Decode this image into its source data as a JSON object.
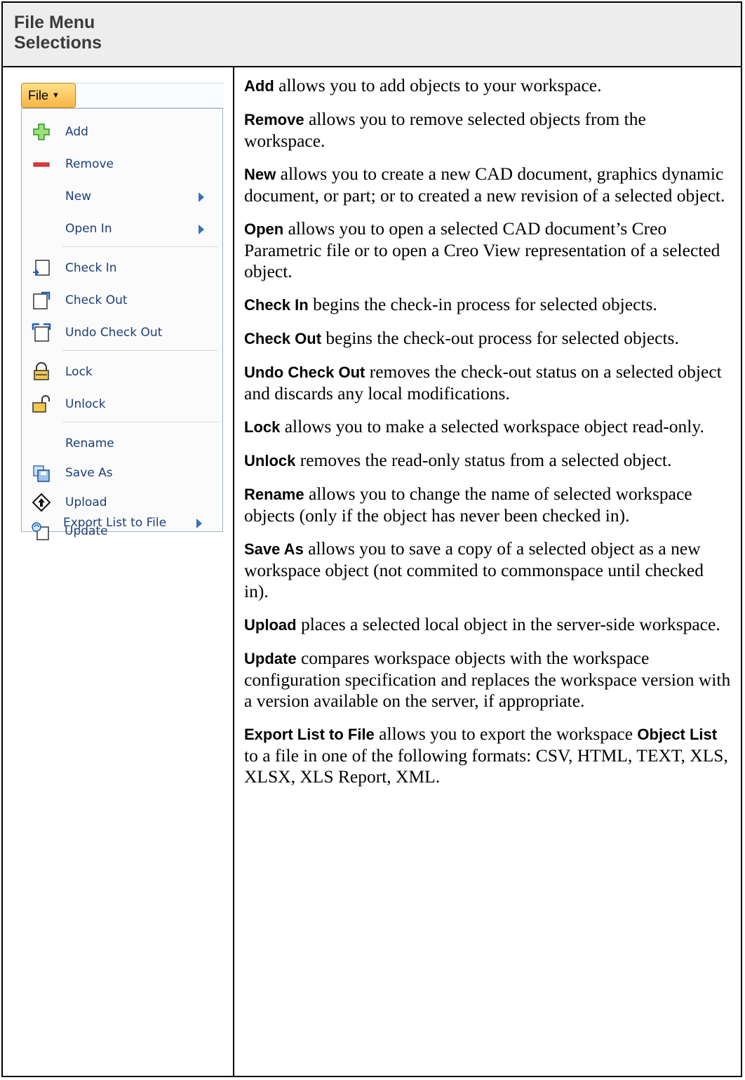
{
  "header": {
    "title_line1": "File Menu",
    "title_line2": "Selections"
  },
  "menu": {
    "file_button": "File",
    "items": [
      {
        "label": "Add",
        "icon": "add-icon",
        "submenu": false
      },
      {
        "label": "Remove",
        "icon": "remove-icon",
        "submenu": false
      },
      {
        "label": "New",
        "icon": "",
        "submenu": true
      },
      {
        "label": "Open In",
        "icon": "",
        "submenu": true
      },
      {
        "label": "Check In",
        "icon": "check-in-icon",
        "submenu": false
      },
      {
        "label": "Check Out",
        "icon": "check-out-icon",
        "submenu": false
      },
      {
        "label": "Undo Check Out",
        "icon": "undo-check-out-icon",
        "submenu": false
      },
      {
        "label": "Lock",
        "icon": "lock-icon",
        "submenu": false
      },
      {
        "label": "Unlock",
        "icon": "unlock-icon",
        "submenu": false
      },
      {
        "label": "Rename",
        "icon": "",
        "submenu": false
      },
      {
        "label": "Save As",
        "icon": "save-as-icon",
        "submenu": false
      },
      {
        "label": "Upload",
        "icon": "upload-icon",
        "submenu": false
      },
      {
        "label": "Update",
        "icon": "update-icon",
        "submenu": false
      },
      {
        "label": "Export List to File",
        "icon": "",
        "submenu": true
      }
    ]
  },
  "descriptions": [
    {
      "term": "Add",
      "text": " allows you to add objects to your workspace."
    },
    {
      "term": "Remove",
      "text": " allows you to remove selected objects from the workspace."
    },
    {
      "term": "New",
      "text": " allows you to create a new CAD document, graphics dynamic document, or part; or to created a new revision of a selected object."
    },
    {
      "term": "Open",
      "text": " allows you to open a selected CAD document’s Creo Parametric file or to open a Creo View representation of a selected object."
    },
    {
      "term": "Check In",
      "text": " begins the check-in process for selected objects."
    },
    {
      "term": "Check Out",
      "text": " begins the check-out process for selected objects."
    },
    {
      "term": "Undo Check Out",
      "text": " removes the check-out status on a selected object and discards any local modifications."
    },
    {
      "term": "Lock",
      "text": " allows you to make a selected workspace object read-only."
    },
    {
      "term": "Unlock",
      "text": " removes the read-only status from a selected object."
    },
    {
      "term": "Rename",
      "text": " allows you to change the name of selected workspace objects (only if the object has never been checked in)."
    },
    {
      "term": "Save As",
      "text": " allows you to save a copy of a selected object as a new workspace object (not commited to commonspace until checked in)."
    },
    {
      "term": "Upload",
      "text": " places a selected local object in the server-side workspace."
    },
    {
      "term": "Update",
      "text": " compares workspace objects with the workspace configuration specification and replaces the workspace version with a version available on the server, if appropriate."
    }
  ],
  "export_description": {
    "term": "Export List to File",
    "text_a": " allows you to export the workspace ",
    "term2": "Object List",
    "text_b": " to a file in one of the following formats: CSV, HTML, TEXT, XLS, XLSX, XLS Report, XML."
  }
}
